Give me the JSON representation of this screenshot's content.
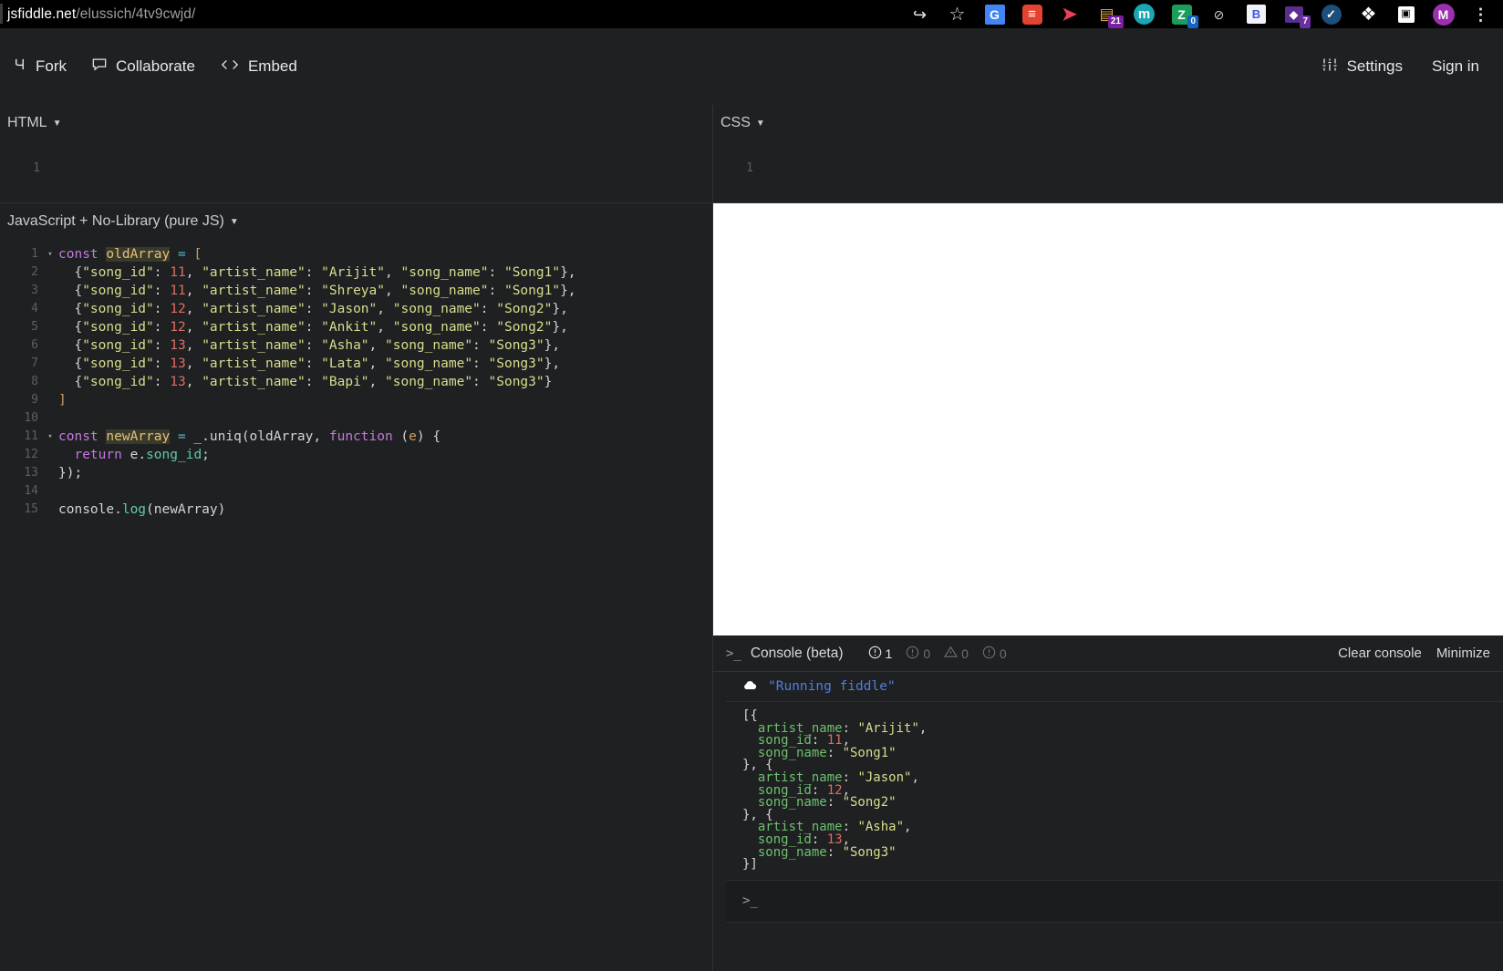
{
  "browser": {
    "url_strong": "jsfiddle.net",
    "url_rest": "/elussich/4tv9cwjd/",
    "extensions": [
      {
        "name": "share-icon",
        "glyph": "↪",
        "badge": null
      },
      {
        "name": "bookmark-star-icon",
        "glyph": "☆",
        "badge": null
      },
      {
        "name": "google-translate-icon",
        "glyph": "G",
        "badge": null
      },
      {
        "name": "todoist-icon",
        "glyph": "≡",
        "badge": null
      },
      {
        "name": "red-arrow-icon",
        "glyph": "➤",
        "badge": null
      },
      {
        "name": "tabs-manager-icon",
        "glyph": "▤",
        "badge": "21"
      },
      {
        "name": "mastodon-icon",
        "glyph": "m",
        "badge": null
      },
      {
        "name": "zotero-icon",
        "glyph": "Z",
        "badge": "0"
      },
      {
        "name": "circle-slash-icon",
        "glyph": "⊘",
        "badge": null
      },
      {
        "name": "bitwarden-icon",
        "glyph": "B",
        "badge": null
      },
      {
        "name": "onenote-icon",
        "glyph": "◆",
        "badge": "7"
      },
      {
        "name": "check-circle-icon",
        "glyph": "✓",
        "badge": null
      },
      {
        "name": "puzzle-extensions-icon",
        "glyph": "❖",
        "badge": null
      },
      {
        "name": "sidebar-toggle-icon",
        "glyph": "▣",
        "badge": null
      },
      {
        "name": "profile-avatar-icon",
        "glyph": "M",
        "badge": null
      },
      {
        "name": "chrome-menu-icon",
        "glyph": "⋮",
        "badge": null
      }
    ]
  },
  "header": {
    "fork_label": "Fork",
    "collaborate_label": "Collaborate",
    "embed_label": "Embed",
    "settings_label": "Settings",
    "signin_label": "Sign in"
  },
  "panes": {
    "html_title": "HTML",
    "css_title": "CSS",
    "js_title": "JavaScript + No-Library (pure JS)",
    "html_line_number": "1",
    "css_line_number": "1"
  },
  "js_code_lines": [
    {
      "n": "1",
      "fold": "▾",
      "tokens": [
        {
          "t": "const ",
          "c": "k-const"
        },
        {
          "t": "oldArray",
          "c": "k-var"
        },
        {
          "t": " ",
          "c": "k-plain"
        },
        {
          "t": "=",
          "c": "k-op"
        },
        {
          "t": " ",
          "c": "k-plain"
        },
        {
          "t": "[",
          "c": "k-brack"
        }
      ]
    },
    {
      "n": "2",
      "fold": "",
      "tokens": [
        {
          "t": "  {",
          "c": "k-plain"
        },
        {
          "t": "\"song_id\"",
          "c": "k-str"
        },
        {
          "t": ": ",
          "c": "k-plain"
        },
        {
          "t": "11",
          "c": "k-num"
        },
        {
          "t": ", ",
          "c": "k-plain"
        },
        {
          "t": "\"artist_name\"",
          "c": "k-str"
        },
        {
          "t": ": ",
          "c": "k-plain"
        },
        {
          "t": "\"Arijit\"",
          "c": "k-str"
        },
        {
          "t": ", ",
          "c": "k-plain"
        },
        {
          "t": "\"song_name\"",
          "c": "k-str"
        },
        {
          "t": ": ",
          "c": "k-plain"
        },
        {
          "t": "\"Song1\"",
          "c": "k-str"
        },
        {
          "t": "},",
          "c": "k-plain"
        }
      ]
    },
    {
      "n": "3",
      "fold": "",
      "tokens": [
        {
          "t": "  {",
          "c": "k-plain"
        },
        {
          "t": "\"song_id\"",
          "c": "k-str"
        },
        {
          "t": ": ",
          "c": "k-plain"
        },
        {
          "t": "11",
          "c": "k-num"
        },
        {
          "t": ", ",
          "c": "k-plain"
        },
        {
          "t": "\"artist_name\"",
          "c": "k-str"
        },
        {
          "t": ": ",
          "c": "k-plain"
        },
        {
          "t": "\"Shreya\"",
          "c": "k-str"
        },
        {
          "t": ", ",
          "c": "k-plain"
        },
        {
          "t": "\"song_name\"",
          "c": "k-str"
        },
        {
          "t": ": ",
          "c": "k-plain"
        },
        {
          "t": "\"Song1\"",
          "c": "k-str"
        },
        {
          "t": "},",
          "c": "k-plain"
        }
      ]
    },
    {
      "n": "4",
      "fold": "",
      "tokens": [
        {
          "t": "  {",
          "c": "k-plain"
        },
        {
          "t": "\"song_id\"",
          "c": "k-str"
        },
        {
          "t": ": ",
          "c": "k-plain"
        },
        {
          "t": "12",
          "c": "k-num"
        },
        {
          "t": ", ",
          "c": "k-plain"
        },
        {
          "t": "\"artist_name\"",
          "c": "k-str"
        },
        {
          "t": ": ",
          "c": "k-plain"
        },
        {
          "t": "\"Jason\"",
          "c": "k-str"
        },
        {
          "t": ", ",
          "c": "k-plain"
        },
        {
          "t": "\"song_name\"",
          "c": "k-str"
        },
        {
          "t": ": ",
          "c": "k-plain"
        },
        {
          "t": "\"Song2\"",
          "c": "k-str"
        },
        {
          "t": "},",
          "c": "k-plain"
        }
      ]
    },
    {
      "n": "5",
      "fold": "",
      "tokens": [
        {
          "t": "  {",
          "c": "k-plain"
        },
        {
          "t": "\"song_id\"",
          "c": "k-str"
        },
        {
          "t": ": ",
          "c": "k-plain"
        },
        {
          "t": "12",
          "c": "k-num"
        },
        {
          "t": ", ",
          "c": "k-plain"
        },
        {
          "t": "\"artist_name\"",
          "c": "k-str"
        },
        {
          "t": ": ",
          "c": "k-plain"
        },
        {
          "t": "\"Ankit\"",
          "c": "k-str"
        },
        {
          "t": ", ",
          "c": "k-plain"
        },
        {
          "t": "\"song_name\"",
          "c": "k-str"
        },
        {
          "t": ": ",
          "c": "k-plain"
        },
        {
          "t": "\"Song2\"",
          "c": "k-str"
        },
        {
          "t": "},",
          "c": "k-plain"
        }
      ]
    },
    {
      "n": "6",
      "fold": "",
      "tokens": [
        {
          "t": "  {",
          "c": "k-plain"
        },
        {
          "t": "\"song_id\"",
          "c": "k-str"
        },
        {
          "t": ": ",
          "c": "k-plain"
        },
        {
          "t": "13",
          "c": "k-num"
        },
        {
          "t": ", ",
          "c": "k-plain"
        },
        {
          "t": "\"artist_name\"",
          "c": "k-str"
        },
        {
          "t": ": ",
          "c": "k-plain"
        },
        {
          "t": "\"Asha\"",
          "c": "k-str"
        },
        {
          "t": ", ",
          "c": "k-plain"
        },
        {
          "t": "\"song_name\"",
          "c": "k-str"
        },
        {
          "t": ": ",
          "c": "k-plain"
        },
        {
          "t": "\"Song3\"",
          "c": "k-str"
        },
        {
          "t": "},",
          "c": "k-plain"
        }
      ]
    },
    {
      "n": "7",
      "fold": "",
      "tokens": [
        {
          "t": "  {",
          "c": "k-plain"
        },
        {
          "t": "\"song_id\"",
          "c": "k-str"
        },
        {
          "t": ": ",
          "c": "k-plain"
        },
        {
          "t": "13",
          "c": "k-num"
        },
        {
          "t": ", ",
          "c": "k-plain"
        },
        {
          "t": "\"artist_name\"",
          "c": "k-str"
        },
        {
          "t": ": ",
          "c": "k-plain"
        },
        {
          "t": "\"Lata\"",
          "c": "k-str"
        },
        {
          "t": ", ",
          "c": "k-plain"
        },
        {
          "t": "\"song_name\"",
          "c": "k-str"
        },
        {
          "t": ": ",
          "c": "k-plain"
        },
        {
          "t": "\"Song3\"",
          "c": "k-str"
        },
        {
          "t": "},",
          "c": "k-plain"
        }
      ]
    },
    {
      "n": "8",
      "fold": "",
      "tokens": [
        {
          "t": "  {",
          "c": "k-plain"
        },
        {
          "t": "\"song_id\"",
          "c": "k-str"
        },
        {
          "t": ": ",
          "c": "k-plain"
        },
        {
          "t": "13",
          "c": "k-num"
        },
        {
          "t": ", ",
          "c": "k-plain"
        },
        {
          "t": "\"artist_name\"",
          "c": "k-str"
        },
        {
          "t": ": ",
          "c": "k-plain"
        },
        {
          "t": "\"Bapi\"",
          "c": "k-str"
        },
        {
          "t": ", ",
          "c": "k-plain"
        },
        {
          "t": "\"song_name\"",
          "c": "k-str"
        },
        {
          "t": ": ",
          "c": "k-plain"
        },
        {
          "t": "\"Song3\"",
          "c": "k-str"
        },
        {
          "t": "}",
          "c": "k-plain"
        }
      ]
    },
    {
      "n": "9",
      "fold": "",
      "tokens": [
        {
          "t": "]",
          "c": "k-brack"
        }
      ]
    },
    {
      "n": "10",
      "fold": "",
      "tokens": []
    },
    {
      "n": "11",
      "fold": "▾",
      "tokens": [
        {
          "t": "const ",
          "c": "k-const"
        },
        {
          "t": "newArray",
          "c": "k-var"
        },
        {
          "t": " ",
          "c": "k-plain"
        },
        {
          "t": "=",
          "c": "k-op"
        },
        {
          "t": " _.",
          "c": "k-plain"
        },
        {
          "t": "uniq",
          "c": "k-plain"
        },
        {
          "t": "(oldArray, ",
          "c": "k-plain"
        },
        {
          "t": "function",
          "c": "k-fn"
        },
        {
          "t": " (",
          "c": "k-plain"
        },
        {
          "t": "e",
          "c": "k-brack"
        },
        {
          "t": ") {",
          "c": "k-plain"
        }
      ]
    },
    {
      "n": "12",
      "fold": "",
      "tokens": [
        {
          "t": "  ",
          "c": "k-plain"
        },
        {
          "t": "return",
          "c": "k-ret"
        },
        {
          "t": " e.",
          "c": "k-plain"
        },
        {
          "t": "song_id",
          "c": "k-prop"
        },
        {
          "t": ";",
          "c": "k-plain"
        }
      ]
    },
    {
      "n": "13",
      "fold": "",
      "tokens": [
        {
          "t": "});",
          "c": "k-plain"
        }
      ]
    },
    {
      "n": "14",
      "fold": "",
      "tokens": []
    },
    {
      "n": "15",
      "fold": "",
      "tokens": [
        {
          "t": "console.",
          "c": "k-plain"
        },
        {
          "t": "log",
          "c": "k-prop"
        },
        {
          "t": "(newArray)",
          "c": "k-plain"
        }
      ]
    }
  ],
  "console": {
    "title": "Console (beta)",
    "prompt_glyph": ">_",
    "counts": [
      {
        "name": "info-count",
        "value": "1",
        "state": "active"
      },
      {
        "name": "log-count",
        "value": "0",
        "state": "dim"
      },
      {
        "name": "warning-count",
        "value": "0",
        "state": "dim"
      },
      {
        "name": "error-count",
        "value": "0",
        "state": "dim"
      }
    ],
    "clear_label": "Clear console",
    "minimize_label": "Minimize",
    "running_message": "\"Running fiddle\"",
    "output_lines": [
      [
        {
          "t": "[{",
          "c": "o-punct"
        }
      ],
      [
        {
          "t": "  ",
          "c": "o-punct"
        },
        {
          "t": "artist_name",
          "c": "o-key"
        },
        {
          "t": ": ",
          "c": "o-punct"
        },
        {
          "t": "\"Arijit\"",
          "c": "o-str"
        },
        {
          "t": ",",
          "c": "o-punct"
        }
      ],
      [
        {
          "t": "  ",
          "c": "o-punct"
        },
        {
          "t": "song_id",
          "c": "o-key"
        },
        {
          "t": ": ",
          "c": "o-punct"
        },
        {
          "t": "11",
          "c": "o-num"
        },
        {
          "t": ",",
          "c": "o-punct"
        }
      ],
      [
        {
          "t": "  ",
          "c": "o-punct"
        },
        {
          "t": "song_name",
          "c": "o-key"
        },
        {
          "t": ": ",
          "c": "o-punct"
        },
        {
          "t": "\"Song1\"",
          "c": "o-str"
        }
      ],
      [
        {
          "t": "}, {",
          "c": "o-punct"
        }
      ],
      [
        {
          "t": "  ",
          "c": "o-punct"
        },
        {
          "t": "artist_name",
          "c": "o-key"
        },
        {
          "t": ": ",
          "c": "o-punct"
        },
        {
          "t": "\"Jason\"",
          "c": "o-str"
        },
        {
          "t": ",",
          "c": "o-punct"
        }
      ],
      [
        {
          "t": "  ",
          "c": "o-punct"
        },
        {
          "t": "song_id",
          "c": "o-key"
        },
        {
          "t": ": ",
          "c": "o-punct"
        },
        {
          "t": "12",
          "c": "o-num"
        },
        {
          "t": ",",
          "c": "o-punct"
        }
      ],
      [
        {
          "t": "  ",
          "c": "o-punct"
        },
        {
          "t": "song_name",
          "c": "o-key"
        },
        {
          "t": ": ",
          "c": "o-punct"
        },
        {
          "t": "\"Song2\"",
          "c": "o-str"
        }
      ],
      [
        {
          "t": "}, {",
          "c": "o-punct"
        }
      ],
      [
        {
          "t": "  ",
          "c": "o-punct"
        },
        {
          "t": "artist_name",
          "c": "o-key"
        },
        {
          "t": ": ",
          "c": "o-punct"
        },
        {
          "t": "\"Asha\"",
          "c": "o-str"
        },
        {
          "t": ",",
          "c": "o-punct"
        }
      ],
      [
        {
          "t": "  ",
          "c": "o-punct"
        },
        {
          "t": "song_id",
          "c": "o-key"
        },
        {
          "t": ": ",
          "c": "o-punct"
        },
        {
          "t": "13",
          "c": "o-num"
        },
        {
          "t": ",",
          "c": "o-punct"
        }
      ],
      [
        {
          "t": "  ",
          "c": "o-punct"
        },
        {
          "t": "song_name",
          "c": "o-key"
        },
        {
          "t": ": ",
          "c": "o-punct"
        },
        {
          "t": "\"Song3\"",
          "c": "o-str"
        }
      ],
      [
        {
          "t": "}]",
          "c": "o-punct"
        }
      ]
    ]
  },
  "colors": {
    "chrome_bg": "#000000",
    "app_bg": "#1e2022",
    "accent_blue": "#4f7fe0",
    "result_bg": "#ffffff"
  }
}
